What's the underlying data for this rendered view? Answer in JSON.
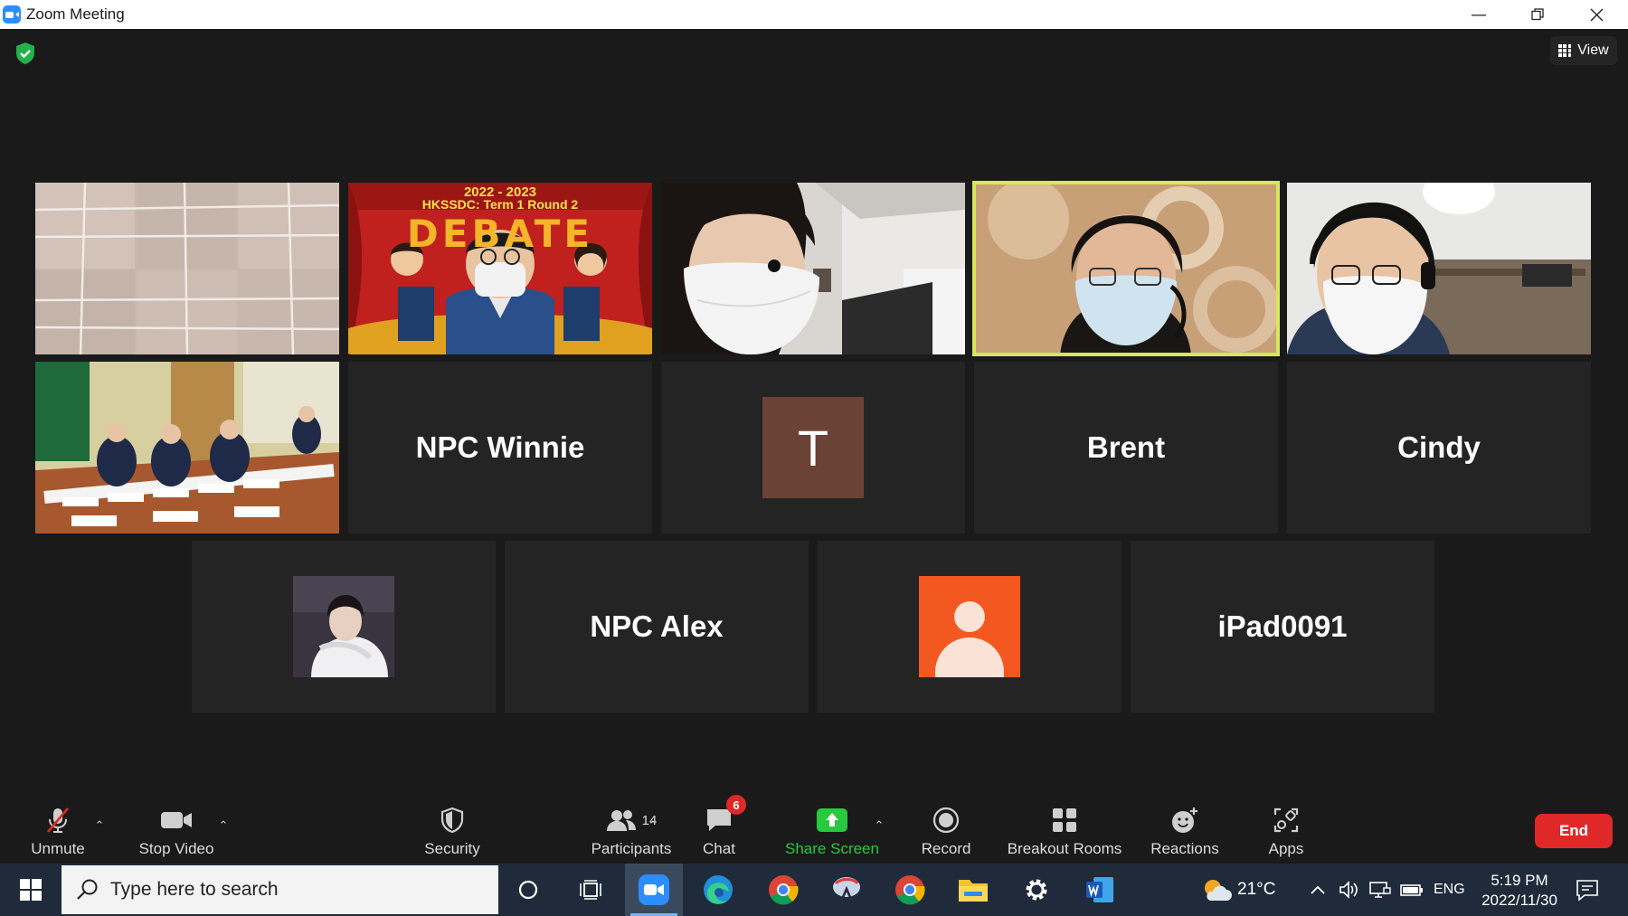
{
  "window": {
    "title": "Zoom Meeting"
  },
  "view_button": {
    "label": "View"
  },
  "participants": [
    {
      "name": "",
      "type": "video-ceiling"
    },
    {
      "name": "",
      "type": "video-debate-teacher"
    },
    {
      "name": "",
      "type": "video-masked-girl"
    },
    {
      "name": "",
      "type": "video-active-speaker"
    },
    {
      "name": "",
      "type": "video-headset-boy"
    },
    {
      "name": "",
      "type": "video-classroom"
    },
    {
      "name": "NPC Winnie",
      "type": "name-only"
    },
    {
      "name": "T",
      "type": "initial-avatar",
      "color": "#6b4236"
    },
    {
      "name": "Brent",
      "type": "name-only"
    },
    {
      "name": "Cindy",
      "type": "name-only"
    },
    {
      "name": "",
      "type": "photo-avatar"
    },
    {
      "name": "NPC Alex",
      "type": "name-only"
    },
    {
      "name": "",
      "type": "default-avatar",
      "color": "#f2581f"
    },
    {
      "name": "iPad0091",
      "type": "name-only"
    }
  ],
  "debate_banner": {
    "years": "2022 - 2023",
    "subtitle": "HKSSDC: Term 1 Round 2",
    "word": "DEBATE"
  },
  "toolbar": {
    "unmute": "Unmute",
    "stop_video": "Stop Video",
    "security": "Security",
    "participants": "Participants",
    "participants_count": "14",
    "chat": "Chat",
    "chat_badge": "6",
    "share_screen": "Share Screen",
    "record": "Record",
    "breakout_rooms": "Breakout Rooms",
    "reactions": "Reactions",
    "apps": "Apps",
    "end": "End"
  },
  "colors": {
    "share_green": "#27c93f",
    "end_red": "#e02828",
    "active_outline": "#d6e85a",
    "security_shield": "#23b14d"
  },
  "taskbar": {
    "search_placeholder": "Type here to search",
    "weather": "21°C",
    "language": "ENG",
    "time": "5:19 PM",
    "date": "2022/11/30"
  }
}
